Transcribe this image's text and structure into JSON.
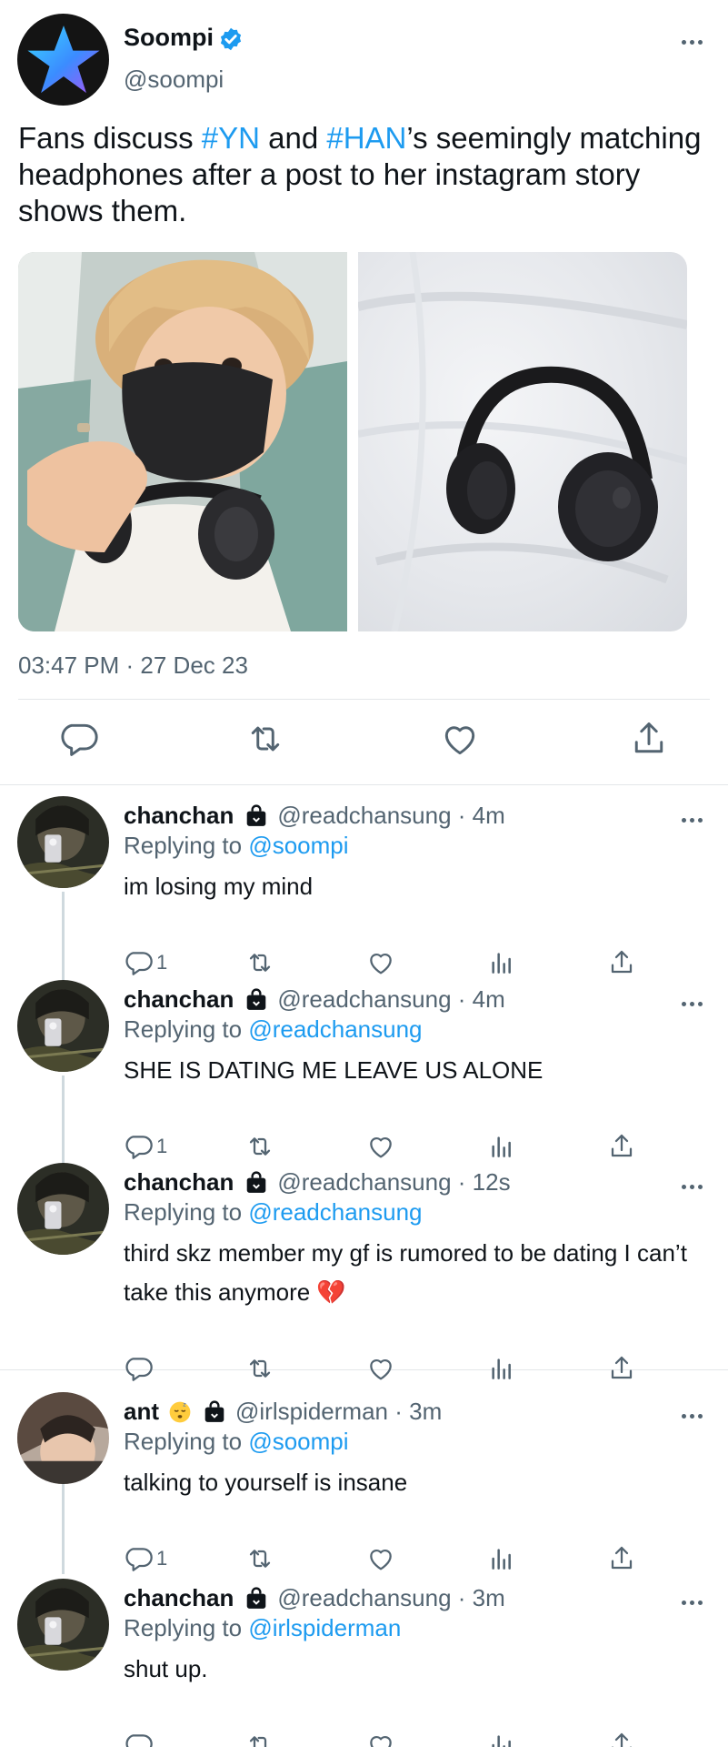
{
  "main_tweet": {
    "author_name": "Soompi",
    "author_handle": "@soompi",
    "text_parts": [
      {
        "text": "Fans discuss ",
        "tag": false
      },
      {
        "text": "#YN",
        "tag": true
      },
      {
        "text": " and ",
        "tag": false
      },
      {
        "text": "#HAN",
        "tag": true
      },
      {
        "text": "’s seemingly matching headphones after a post to her instagram story shows them.",
        "tag": false
      }
    ],
    "timestamp": "03:47 PM · 27 Dec 23",
    "icons": [
      "reply-icon",
      "retweet-icon",
      "like-icon",
      "share-icon"
    ]
  },
  "replies": [
    {
      "name": "chanchan",
      "handle_time": "@readchansung · 4m",
      "replying_prefix": "Replying to ",
      "replying_to": "@soompi",
      "text": "im losing my mind",
      "reply_count": "1",
      "emoji": false
    },
    {
      "name": "chanchan",
      "handle_time": "@readchansung · 4m",
      "replying_prefix": "Replying to ",
      "replying_to": "@readchansung",
      "text": "SHE IS DATING ME LEAVE US ALONE",
      "reply_count": "1",
      "emoji": false
    },
    {
      "name": "chanchan",
      "handle_time": "@readchansung · 12s",
      "replying_prefix": "Replying to ",
      "replying_to": "@readchansung",
      "text": "third skz member my gf is rumored to be dating I can’t take this anymore 💔",
      "reply_count": "",
      "emoji": false
    },
    {
      "name": "ant",
      "handle_time": "@irlspiderman · 3m",
      "replying_prefix": "Replying to ",
      "replying_to": "@soompi",
      "text": "talking to yourself is insane",
      "reply_count": "1",
      "emoji": true
    },
    {
      "name": "chanchan",
      "handle_time": "@readchansung · 3m",
      "replying_prefix": "Replying to ",
      "replying_to": "@irlspiderman",
      "text": "shut up.",
      "reply_count": "",
      "emoji": false
    }
  ],
  "colors": {
    "accent": "#1d9bf0",
    "text": "#0f1419",
    "secondary": "#536471",
    "divider": "#e3e6e9"
  }
}
